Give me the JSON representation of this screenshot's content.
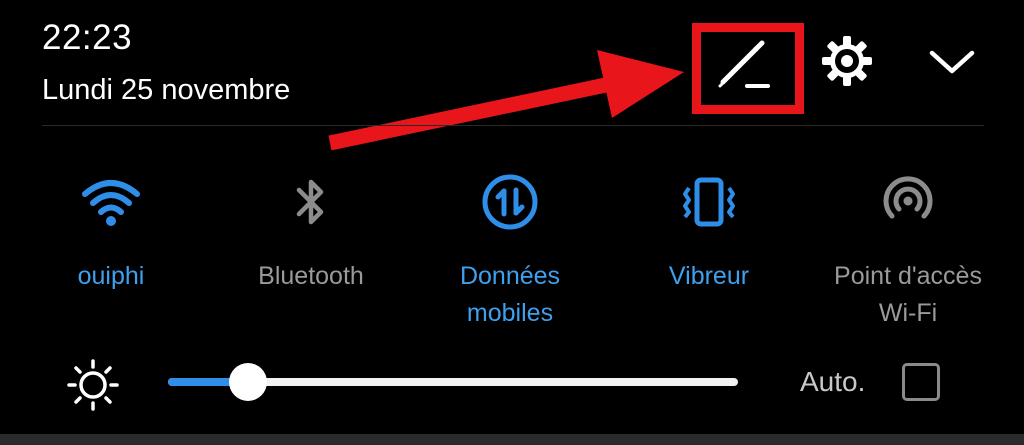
{
  "header": {
    "time": "22:23",
    "date": "Lundi 25 novembre",
    "edit_icon": "pencil-icon",
    "settings_icon": "gear-icon",
    "expand_icon": "chevron-down-icon"
  },
  "tiles": [
    {
      "label": "ouiphi",
      "icon": "wifi-icon",
      "active": true
    },
    {
      "label": "Bluetooth",
      "icon": "bluetooth-icon",
      "active": false
    },
    {
      "label": "Données\nmobiles",
      "icon": "mobile-data-icon",
      "active": true
    },
    {
      "label": "Vibreur",
      "icon": "vibrate-icon",
      "active": true
    },
    {
      "label": "Point d'accès\nWi-Fi",
      "icon": "hotspot-icon",
      "active": false
    }
  ],
  "brightness": {
    "icon": "brightness-icon",
    "level": 0.14,
    "auto_label": "Auto.",
    "auto_checked": false
  },
  "colors": {
    "accent": "#3fa0ee",
    "inactive": "#9a9a9a",
    "annotation": "#e8161b",
    "background": "#000000"
  }
}
